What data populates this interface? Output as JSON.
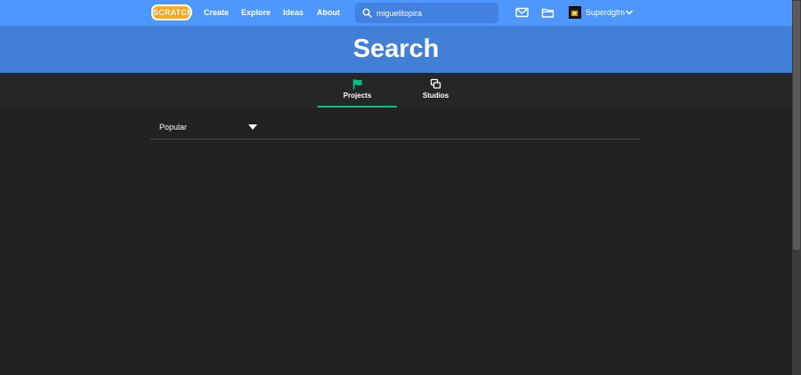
{
  "nav": {
    "logo_text": "SCRATCH",
    "links": [
      "Create",
      "Explore",
      "Ideas",
      "About"
    ],
    "search": {
      "value": "miguelitopira",
      "placeholder": "Search"
    },
    "username": "Superdgfm",
    "icons": {
      "search": "search-icon",
      "messages": "envelope-icon",
      "my_stuff": "folder-icon",
      "account_menu": "chevron-down-icon"
    }
  },
  "banner": {
    "title": "Search"
  },
  "tabs": [
    {
      "label": "Projects",
      "icon": "flag-icon",
      "active": true
    },
    {
      "label": "Studios",
      "icon": "studio-icon",
      "active": false
    }
  ],
  "sort": {
    "selected": "Popular",
    "icon": "dropdown-caret-icon"
  },
  "colors": {
    "nav_bg": "#4d97ff",
    "banner_bg": "#4280d7",
    "page_bg": "#222222",
    "tab_active": "#0fbd8c",
    "logo": "#ffab19"
  }
}
